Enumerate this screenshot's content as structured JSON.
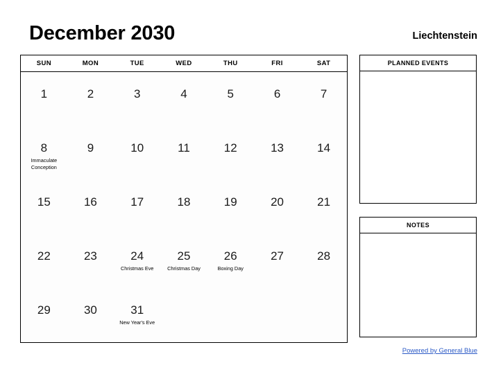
{
  "header": {
    "month_title": "December 2030",
    "country": "Liechtenstein"
  },
  "calendar": {
    "weekday_headers": [
      "SUN",
      "MON",
      "TUE",
      "WED",
      "THU",
      "FRI",
      "SAT"
    ],
    "weeks": [
      [
        {
          "day": "1",
          "event": ""
        },
        {
          "day": "2",
          "event": ""
        },
        {
          "day": "3",
          "event": ""
        },
        {
          "day": "4",
          "event": ""
        },
        {
          "day": "5",
          "event": ""
        },
        {
          "day": "6",
          "event": ""
        },
        {
          "day": "7",
          "event": ""
        }
      ],
      [
        {
          "day": "8",
          "event": "Immaculate Conception"
        },
        {
          "day": "9",
          "event": ""
        },
        {
          "day": "10",
          "event": ""
        },
        {
          "day": "11",
          "event": ""
        },
        {
          "day": "12",
          "event": ""
        },
        {
          "day": "13",
          "event": ""
        },
        {
          "day": "14",
          "event": ""
        }
      ],
      [
        {
          "day": "15",
          "event": ""
        },
        {
          "day": "16",
          "event": ""
        },
        {
          "day": "17",
          "event": ""
        },
        {
          "day": "18",
          "event": ""
        },
        {
          "day": "19",
          "event": ""
        },
        {
          "day": "20",
          "event": ""
        },
        {
          "day": "21",
          "event": ""
        }
      ],
      [
        {
          "day": "22",
          "event": ""
        },
        {
          "day": "23",
          "event": ""
        },
        {
          "day": "24",
          "event": "Christmas Eve"
        },
        {
          "day": "25",
          "event": "Christmas Day"
        },
        {
          "day": "26",
          "event": "Boxing Day"
        },
        {
          "day": "27",
          "event": ""
        },
        {
          "day": "28",
          "event": ""
        }
      ],
      [
        {
          "day": "29",
          "event": ""
        },
        {
          "day": "30",
          "event": ""
        },
        {
          "day": "31",
          "event": "New Year's Eve"
        },
        {
          "day": "",
          "event": ""
        },
        {
          "day": "",
          "event": ""
        },
        {
          "day": "",
          "event": ""
        },
        {
          "day": "",
          "event": ""
        }
      ]
    ]
  },
  "panels": {
    "planned_events": {
      "title": "PLANNED EVENTS",
      "content": ""
    },
    "notes": {
      "title": "NOTES",
      "content": ""
    }
  },
  "footer": {
    "powered_by": "Powered by General Blue"
  },
  "colors": {
    "link": "#2a59c6",
    "border": "#000000",
    "text": "#000000"
  }
}
